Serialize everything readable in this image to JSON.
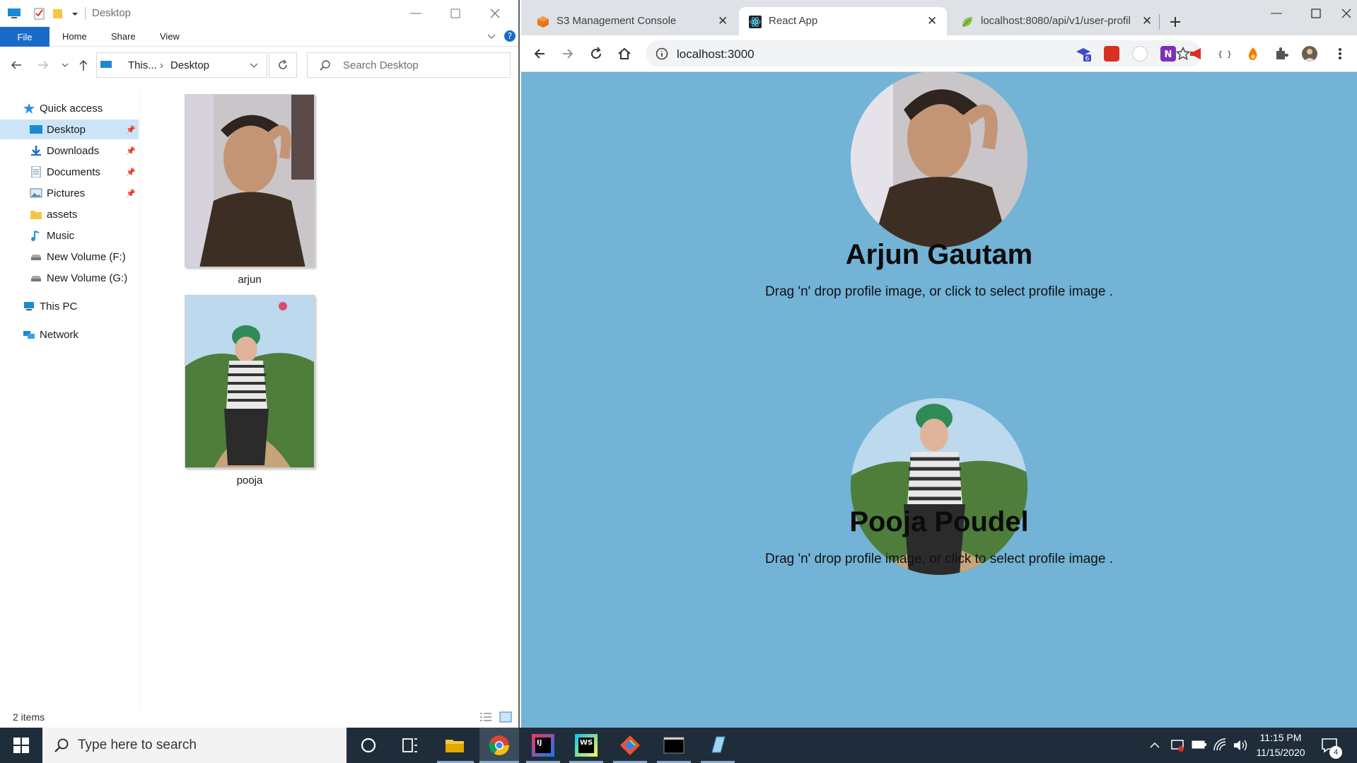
{
  "explorer": {
    "title": "Desktop",
    "ribbon_tabs": {
      "file": "File",
      "home": "Home",
      "share": "Share",
      "view": "View"
    },
    "address": {
      "root": "This...",
      "folder": "Desktop"
    },
    "search_placeholder": "Search Desktop",
    "nav": {
      "quick_access": "Quick access",
      "desktop": "Desktop",
      "downloads": "Downloads",
      "documents": "Documents",
      "pictures": "Pictures",
      "assets": "assets",
      "music": "Music",
      "vol_f": "New Volume (F:)",
      "vol_g": "New Volume (G:)",
      "this_pc": "This PC",
      "network": "Network"
    },
    "files": [
      {
        "name": "arjun"
      },
      {
        "name": "pooja"
      }
    ],
    "status": "2 items"
  },
  "browser": {
    "tabs": [
      {
        "title": "S3 Management Console"
      },
      {
        "title": "React App"
      },
      {
        "title": "localhost:8080/api/v1/user-profil"
      }
    ],
    "url": "localhost:3000",
    "profiles": [
      {
        "name": "Arjun Gautam",
        "message": "Drag 'n' drop profile image, or click to select profile image ."
      },
      {
        "name": "Pooja Poudel",
        "message": "Drag 'n' drop profile image, or click to select profile image ."
      }
    ],
    "ext_badge": "6",
    "ext_json_label": "{ }"
  },
  "taskbar": {
    "search_placeholder": "Type here to search",
    "time": "11:15 PM",
    "date": "11/15/2020",
    "notification_count": "4",
    "ide_labels": {
      "intellij": "IJ",
      "webstorm": "WS"
    }
  },
  "colors": {
    "page_bg": "#72b3d6",
    "taskbar_bg": "#1f2d3a",
    "tabstrip_bg": "#dee1e6",
    "explorer_selection": "#cce4f7",
    "file_tab": "#1a6bc9"
  }
}
